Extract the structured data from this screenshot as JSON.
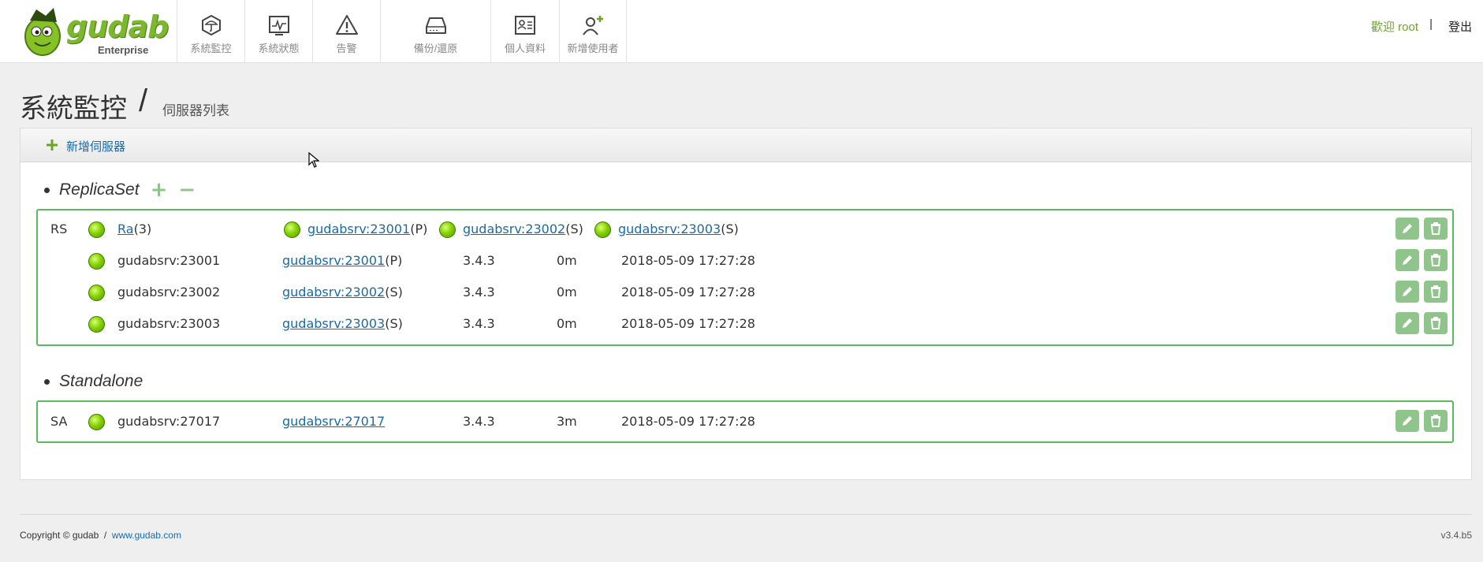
{
  "brand": {
    "name": "gudab",
    "edition": "Enterprise"
  },
  "nav": [
    {
      "label": "系統監控",
      "icon": "umbrella-monitor-icon"
    },
    {
      "label": "系統狀態",
      "icon": "pulse-chart-icon"
    },
    {
      "label": "告警",
      "icon": "warning-triangle-icon"
    },
    {
      "label": "備份/還原",
      "icon": "hard-drive-icon"
    },
    {
      "label": "個人資料",
      "icon": "id-card-icon"
    },
    {
      "label": "新增使用者",
      "icon": "add-user-icon"
    }
  ],
  "user": {
    "welcome": "歡迎 root",
    "separator": "|",
    "logout": "登出"
  },
  "page": {
    "title": "系統監控",
    "slash": "/",
    "subtitle": "伺服器列表"
  },
  "toolbar": {
    "add_server": "新增伺服器"
  },
  "replica_set": {
    "title": "ReplicaSet",
    "add_symbol": "+",
    "remove_symbol": "−",
    "summary": {
      "type": "RS",
      "name": "Ra",
      "count": "(3)",
      "members": [
        {
          "host": "gudabsrv:23001",
          "role": "(P)"
        },
        {
          "host": "gudabsrv:23002",
          "role": "(S)"
        },
        {
          "host": "gudabsrv:23003",
          "role": "(S)"
        }
      ]
    },
    "rows": [
      {
        "name": "gudabsrv:23001",
        "host": "gudabsrv:23001",
        "role": "(P)",
        "version": "3.4.3",
        "uptime": "0m",
        "timestamp": "2018-05-09 17:27:28"
      },
      {
        "name": "gudabsrv:23002",
        "host": "gudabsrv:23002",
        "role": "(S)",
        "version": "3.4.3",
        "uptime": "0m",
        "timestamp": "2018-05-09 17:27:28"
      },
      {
        "name": "gudabsrv:23003",
        "host": "gudabsrv:23003",
        "role": "(S)",
        "version": "3.4.3",
        "uptime": "0m",
        "timestamp": "2018-05-09 17:27:28"
      }
    ]
  },
  "standalone": {
    "title": "Standalone",
    "rows": [
      {
        "type": "SA",
        "name": "gudabsrv:27017",
        "host": "gudabsrv:27017",
        "version": "3.4.3",
        "uptime": "3m",
        "timestamp": "2018-05-09 17:27:28"
      }
    ]
  },
  "footer": {
    "copyright": "Copyright © gudab  /  ",
    "site": "www.gudab.com",
    "version": "v3.4.b5"
  },
  "colors": {
    "accent": "#6aa528",
    "status_ok": "#86d200",
    "link": "#1a6aa8",
    "group_border": "#5cb85c",
    "action_button": "#8fc48a"
  }
}
